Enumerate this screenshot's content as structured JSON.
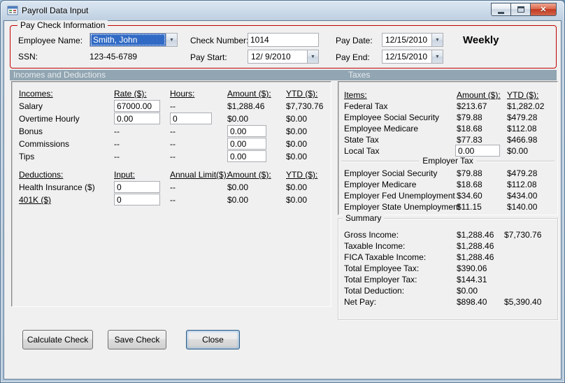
{
  "window": {
    "title": "Payroll Data Input"
  },
  "icons": {
    "dropdown": "▼",
    "close_glyph": "✕"
  },
  "colors": {
    "group_border": "#C00000",
    "header_bar": "#91A5B2",
    "selection": "#316AC5"
  },
  "paycheck": {
    "group_title": "Pay Check Information",
    "employee_name_label": "Employee Name:",
    "employee_name_value": "Smith, John",
    "ssn_label": "SSN:",
    "ssn_value": "123-45-6789",
    "check_number_label": "Check Number:",
    "check_number_value": "1014",
    "pay_start_label": "Pay Start:",
    "pay_start_value": "12/ 9/2010",
    "pay_date_label": "Pay Date:",
    "pay_date_value": "12/15/2010",
    "pay_end_label": "Pay End:",
    "pay_end_value": "12/15/2010",
    "frequency": "Weekly"
  },
  "section_headers": {
    "incomes_deductions": "Incomes and Deductions",
    "taxes": "Taxes"
  },
  "incomes": {
    "headers": {
      "name": "Incomes:",
      "rate": "Rate ($):",
      "hours": "Hours:",
      "amount": "Amount ($):",
      "ytd": "YTD ($):"
    },
    "rows": [
      {
        "label": "Salary",
        "rate": "67000.00",
        "hours": "--",
        "amount": "$1,288.46",
        "ytd": "$7,730.76"
      },
      {
        "label": "Overtime Hourly",
        "rate": "0.00",
        "hours": "0",
        "amount": "$0.00",
        "ytd": "$0.00"
      },
      {
        "label": "Bonus",
        "rate": "--",
        "hours": "--",
        "amount": "0.00",
        "ytd": "$0.00"
      },
      {
        "label": "Commissions",
        "rate": "--",
        "hours": "--",
        "amount": "0.00",
        "ytd": "$0.00"
      },
      {
        "label": "Tips",
        "rate": "--",
        "hours": "--",
        "amount": "0.00",
        "ytd": "$0.00"
      }
    ]
  },
  "deductions": {
    "headers": {
      "name": "Deductions:",
      "input": "Input:",
      "annual_limit": "Annual Limit($):",
      "amount": "Amount ($):",
      "ytd": "YTD ($):"
    },
    "rows": [
      {
        "label": "Health Insurance ($)",
        "input": "0",
        "annual_limit": "--",
        "amount": "$0.00",
        "ytd": "$0.00"
      },
      {
        "label": "401K ($)",
        "input": "0",
        "annual_limit": "--",
        "amount": "$0.00",
        "ytd": "$0.00"
      }
    ]
  },
  "taxes": {
    "headers": {
      "items": "Items:",
      "amount": "Amount ($):",
      "ytd": "YTD ($):"
    },
    "employee_rows": [
      {
        "label": "Federal Tax",
        "amount": "$213.67",
        "ytd": "$1,282.02"
      },
      {
        "label": "Employee Social Security",
        "amount": "$79.88",
        "ytd": "$479.28"
      },
      {
        "label": "Employee Medicare",
        "amount": "$18.68",
        "ytd": "$112.08"
      },
      {
        "label": "State Tax",
        "amount": "$77.83",
        "ytd": "$466.98"
      },
      {
        "label": "Local Tax",
        "amount": "0.00",
        "ytd": "$0.00"
      }
    ],
    "employer_header": "Employer Tax",
    "employer_rows": [
      {
        "label": "Employer Social Security",
        "amount": "$79.88",
        "ytd": "$479.28"
      },
      {
        "label": "Employer Medicare",
        "amount": "$18.68",
        "ytd": "$112.08"
      },
      {
        "label": "Employer Fed Unemployment",
        "amount": "$34.60",
        "ytd": "$434.00"
      },
      {
        "label": "Employer State Unemployment",
        "amount": "$11.15",
        "ytd": "$140.00"
      }
    ]
  },
  "summary": {
    "group_title": "Summary",
    "rows": [
      {
        "label": "Gross Income:",
        "amount": "$1,288.46",
        "ytd": "$7,730.76"
      },
      {
        "label": "Taxable Income:",
        "amount": "$1,288.46",
        "ytd": ""
      },
      {
        "label": "FICA Taxable Income:",
        "amount": "$1,288.46",
        "ytd": ""
      },
      {
        "label": "Total Employee Tax:",
        "amount": "$390.06",
        "ytd": ""
      },
      {
        "label": "Total Employer Tax:",
        "amount": "$144.31",
        "ytd": ""
      },
      {
        "label": "Total Deduction:",
        "amount": "$0.00",
        "ytd": ""
      },
      {
        "label": "Net Pay:",
        "amount": "$898.40",
        "ytd": "$5,390.40"
      }
    ]
  },
  "buttons": {
    "calculate": "Calculate Check",
    "save": "Save Check",
    "close": "Close"
  }
}
